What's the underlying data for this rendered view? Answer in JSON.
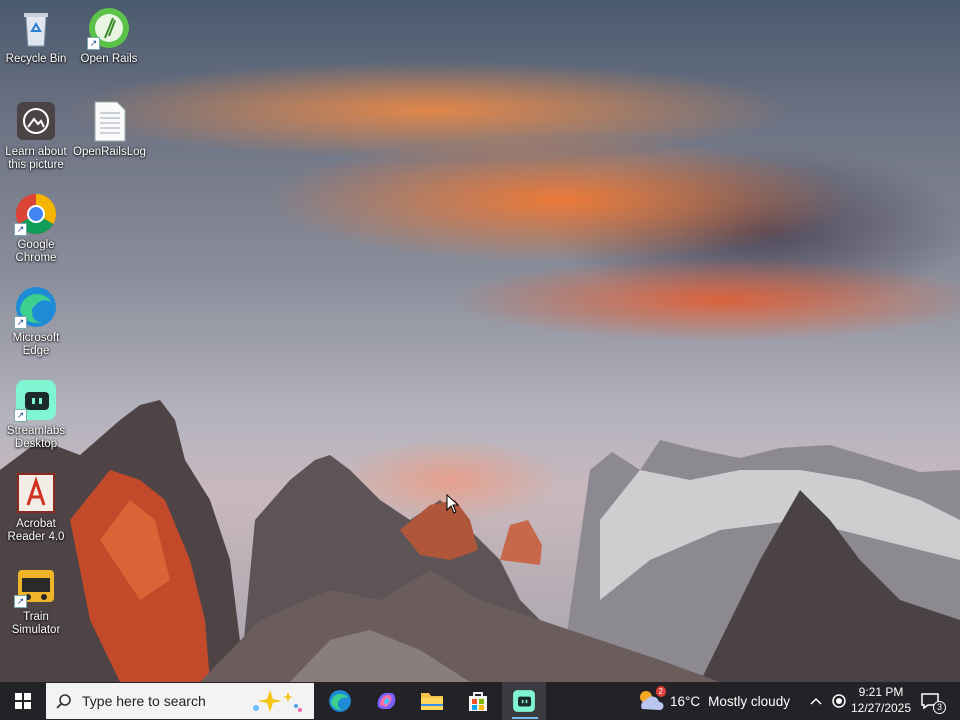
{
  "desktop": {
    "icons": [
      {
        "label": "Recycle Bin",
        "icon": "recycle-bin-icon"
      },
      {
        "label": "Open Rails",
        "icon": "open-rails-icon"
      },
      {
        "label": "Learn about this picture",
        "icon": "learn-picture-icon"
      },
      {
        "label": "OpenRailsLog",
        "icon": "text-file-icon"
      },
      {
        "label": "Google Chrome",
        "icon": "chrome-icon"
      },
      {
        "label": "Microsoft Edge",
        "icon": "edge-icon"
      },
      {
        "label": "Streamlabs Desktop",
        "icon": "streamlabs-icon"
      },
      {
        "label": "Acrobat Reader 4.0",
        "icon": "acrobat-icon"
      },
      {
        "label": "Train Simulator",
        "icon": "train-simulator-icon"
      }
    ]
  },
  "taskbar": {
    "search_placeholder": "Type here to search",
    "apps": [
      "edge-icon",
      "copilot-icon",
      "file-explorer-icon",
      "store-icon",
      "streamlabs-icon"
    ],
    "active_app": "streamlabs-icon",
    "weather": {
      "temp": "16°C",
      "condition": "Mostly cloudy",
      "badge": "2"
    },
    "time": "9:21 PM",
    "date": "12/27/2025",
    "notification_count": "3"
  },
  "colors": {
    "taskbar_bg": "#222227",
    "search_bg": "#f3f3f3",
    "active_indicator": "#76b9ed"
  }
}
